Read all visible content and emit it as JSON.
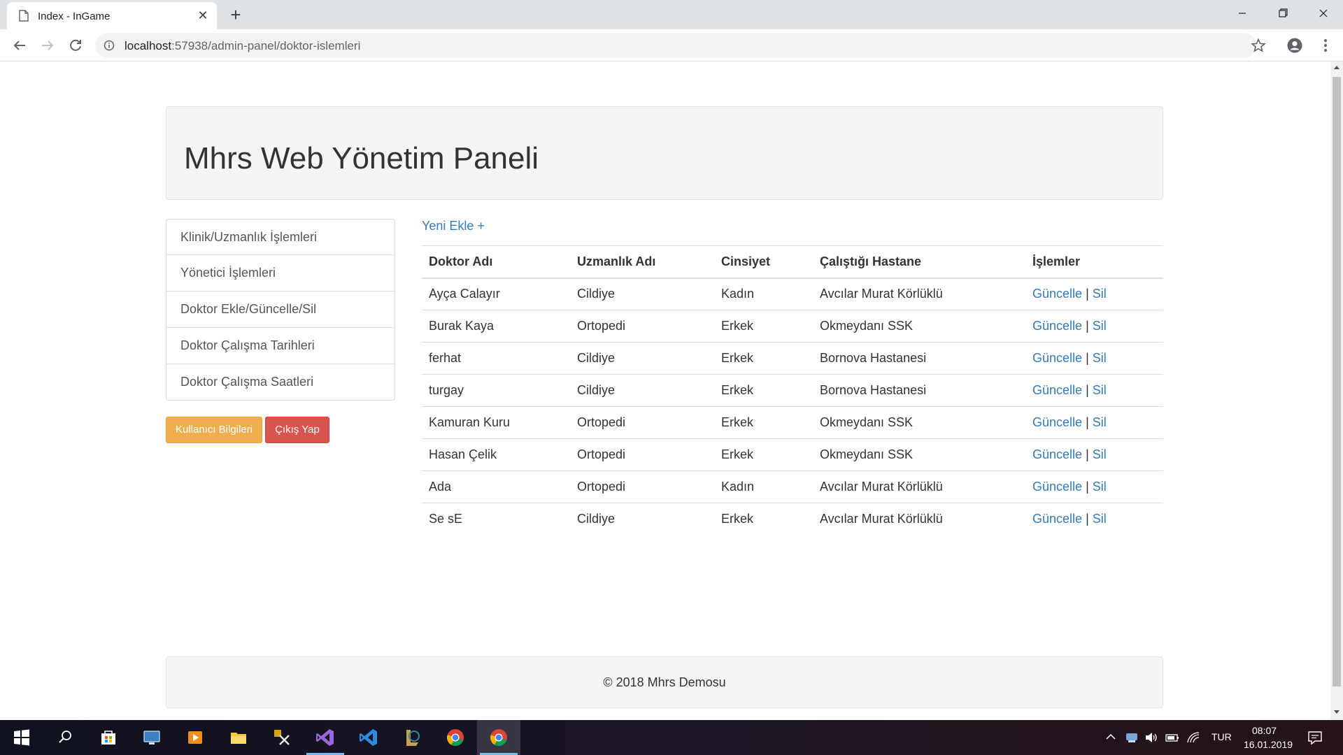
{
  "browser": {
    "tab_title": "Index - InGame",
    "url_host": "localhost",
    "url_rest": ":57938/admin-panel/doktor-islemleri"
  },
  "page": {
    "heading": "Mhrs Web Yönetim Paneli",
    "sidebar": [
      {
        "label": "Klinik/Uzmanlık İşlemleri"
      },
      {
        "label": "Yönetici İşlemleri"
      },
      {
        "label": "Doktor Ekle/Güncelle/Sil"
      },
      {
        "label": "Doktor Çalışma Tarihleri"
      },
      {
        "label": "Doktor Çalışma Saatleri"
      }
    ],
    "user_info_button": "Kullanıcı Bilgileri",
    "logout_button": "Çıkış Yap",
    "add_new_link": "Yeni Ekle +",
    "table": {
      "headers": [
        "Doktor Adı",
        "Uzmanlık Adı",
        "Cinsiyet",
        "Çalıştığı Hastane",
        "İşlemler"
      ],
      "update_label": "Güncelle",
      "delete_label": "Sil",
      "separator": "|",
      "rows": [
        [
          "Ayça Calayır",
          "Cildiye",
          "Kadın",
          "Avcılar Murat Körlüklü"
        ],
        [
          "Burak Kaya",
          "Ortopedi",
          "Erkek",
          "Okmeydanı SSK"
        ],
        [
          "ferhat",
          "Cildiye",
          "Erkek",
          "Bornova Hastanesi"
        ],
        [
          "turgay",
          "Cildiye",
          "Erkek",
          "Bornova Hastanesi"
        ],
        [
          "Kamuran Kuru",
          "Ortopedi",
          "Erkek",
          "Okmeydanı SSK"
        ],
        [
          "Hasan Çelik",
          "Ortopedi",
          "Erkek",
          "Okmeydanı SSK"
        ],
        [
          "Ada",
          "Ortopedi",
          "Kadın",
          "Avcılar Murat Körlüklü"
        ],
        [
          "Se sE",
          "Cildiye",
          "Erkek",
          "Avcılar Murat Körlüklü"
        ]
      ]
    },
    "footer": "© 2018 Mhrs Demosu"
  },
  "taskbar": {
    "apps": [
      "windows-start-icon",
      "search-icon",
      "store-icon",
      "computer-icon",
      "media-player-icon",
      "file-explorer-icon",
      "tools-icon",
      "visual-studio-icon",
      "vs-code-icon",
      "game-icon",
      "chrome-icon",
      "chrome-active-icon"
    ],
    "language": "TUR",
    "time": "08:07",
    "date": "16.01.2019"
  },
  "colors": {
    "link": "#337ab7",
    "warning": "#f0ad4e",
    "danger": "#d9534f",
    "panel_bg": "#f5f5f5"
  }
}
